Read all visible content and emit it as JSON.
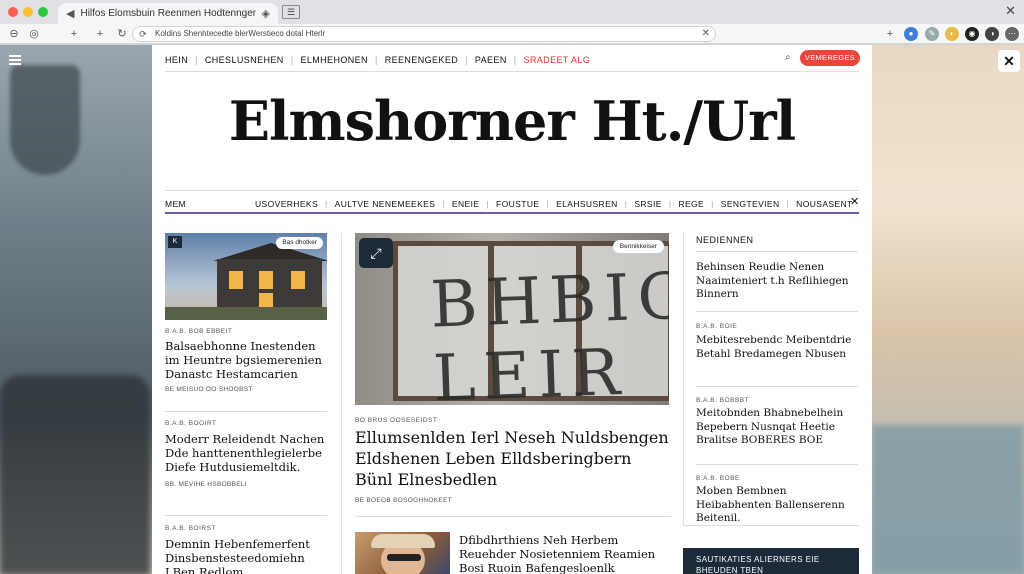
{
  "browser": {
    "tab_title": "Hilfos Elomsbuin Reenmen Hodtenngen",
    "url": "Koldins Shenhtecedte blerWerstieco dotal Hterlr"
  },
  "site": {
    "util_nav": [
      "HEIN",
      "CHESLUSNEHEN",
      "ELMHEHONEN",
      "REENENGEKED",
      "PAEEN",
      "SRADEET ALG"
    ],
    "util_cta": "VEMEREGES",
    "masthead": "Elmshorner Ht./Url",
    "section_nav_first": "MEM",
    "section_nav": [
      "USOVERHEKS",
      "AULTVE NENEMEEKES",
      "ENEIE",
      "FOUSTUE",
      "ELAHSUSREN",
      "SRSIE",
      "REGE",
      "SENGTEVIEN",
      "NOUSASENT"
    ]
  },
  "left_column": {
    "badge": "K",
    "image_pill": "Bas dhotker",
    "articles": [
      {
        "kicker": "B.A.B. BOB EBBEIT",
        "headline": "Balsaebhonne Inestenden im Heuntre bgsiemerenien Danastc Hestamcarien",
        "byline": "BE MEISUO OO SHOOBST"
      },
      {
        "kicker": "B.A.B. BOOIRT",
        "headline": "Moderr Releidendt Nachen Dde hanttenenthlegielerbe Diefe Hutdusiemeltdik.",
        "byline": "BB. MEVIHE HSBOBBELI"
      },
      {
        "kicker": "B.A.B. BOIRST",
        "headline": "Demnin Hebenfemerfent Dinsbenstesteedomiehn LBen Redlom",
        "byline": ""
      }
    ]
  },
  "center_column": {
    "image_pill": "Bennikkeiser",
    "image_text": "BHBIGS LEIR ER",
    "kicker": "BO BRUS OOSESEIDST",
    "headline": "Ellumsenlden Ierl Neseh Nuldsbengen Eldshenen Leben Elldsberingbern Bünl Elnesbedlen",
    "byline": "BE BOEOB BOSOGHNOKEET",
    "second_headline": "Dfibdhrthiens Neh Herbem Reuehder Nosietenniem Reamien Bosi Ruoin Bafengesloenlk"
  },
  "right_column": {
    "title": "NEDIENNEN",
    "items": [
      {
        "kicker": "",
        "headline": "Behinsen Reudie Nenen Naaimteniert t.h Reflihiegen Binnern"
      },
      {
        "kicker": "B.A.B. BOIE",
        "headline": "Mebitesrebendc Meibentdrie Betahl Bredamegen Nbusen"
      },
      {
        "kicker": "B.A.B. BOBBBT",
        "headline": "Meitobnden Bhabnebelhein Bepebern Nusnqat Heetie Bralitse BOBERES BOE"
      },
      {
        "kicker": "B.A.B. BOBE",
        "headline": "Moben Bembnen Heibabhenten Ballenserenn Beitenil."
      }
    ],
    "promo": "SAUTIKATIES ALIERNERS EIE BHEUDEN TBEN"
  },
  "icons": [
    "hamburger-icon",
    "search-icon",
    "close-icon",
    "expand-icon"
  ]
}
